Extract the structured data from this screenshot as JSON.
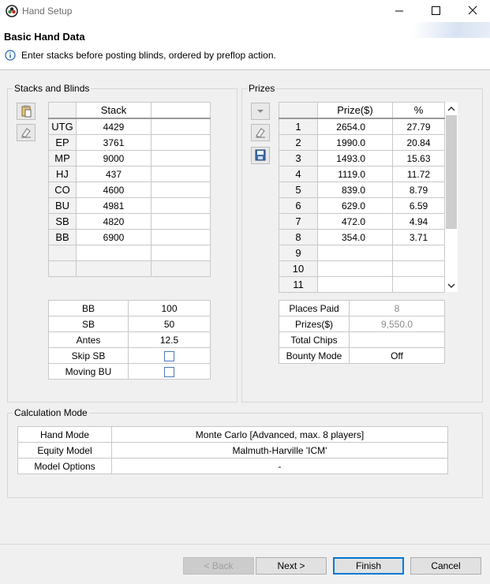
{
  "window": {
    "title": "Hand Setup",
    "controls": [
      "minimize",
      "maximize",
      "close"
    ]
  },
  "header": {
    "title": "Basic Hand Data",
    "info": "Enter stacks before posting blinds, ordered by preflop action."
  },
  "stacks": {
    "group_label": "Stacks and Blinds",
    "column_header": "Stack",
    "rows": [
      {
        "pos": "UTG",
        "stack": "4429"
      },
      {
        "pos": "EP",
        "stack": "3761"
      },
      {
        "pos": "MP",
        "stack": "9000"
      },
      {
        "pos": "HJ",
        "stack": "437"
      },
      {
        "pos": "CO",
        "stack": "4600"
      },
      {
        "pos": "BU",
        "stack": "4981"
      },
      {
        "pos": "SB",
        "stack": "4820"
      },
      {
        "pos": "BB",
        "stack": "6900"
      }
    ],
    "blinds": [
      {
        "label": "BB",
        "value": "100"
      },
      {
        "label": "SB",
        "value": "50"
      },
      {
        "label": "Antes",
        "value": "12.5"
      },
      {
        "label": "Skip SB",
        "checkbox": true
      },
      {
        "label": "Moving BU",
        "checkbox": true
      }
    ]
  },
  "prizes": {
    "group_label": "Prizes",
    "col_prize": "Prize($)",
    "col_pct": "%",
    "rows": [
      {
        "place": "1",
        "prize": "2654.0",
        "pct": "27.79"
      },
      {
        "place": "2",
        "prize": "1990.0",
        "pct": "20.84"
      },
      {
        "place": "3",
        "prize": "1493.0",
        "pct": "15.63"
      },
      {
        "place": "4",
        "prize": "1119.0",
        "pct": "11.72"
      },
      {
        "place": "5",
        "prize": "839.0",
        "pct": "8.79"
      },
      {
        "place": "6",
        "prize": "629.0",
        "pct": "6.59"
      },
      {
        "place": "7",
        "prize": "472.0",
        "pct": "4.94"
      },
      {
        "place": "8",
        "prize": "354.0",
        "pct": "3.71"
      },
      {
        "place": "9",
        "prize": "",
        "pct": ""
      },
      {
        "place": "10",
        "prize": "",
        "pct": ""
      },
      {
        "place": "11",
        "prize": "",
        "pct": ""
      }
    ],
    "summary": [
      {
        "label": "Places Paid",
        "value": "8"
      },
      {
        "label": "Prizes($)",
        "value": "9,550.0"
      },
      {
        "label": "Total Chips",
        "value": ""
      },
      {
        "label": "Bounty Mode",
        "value": "Off"
      }
    ]
  },
  "calc": {
    "group_label": "Calculation Mode",
    "rows": [
      {
        "label": "Hand Mode",
        "value": "Monte Carlo [Advanced, max. 8 players]"
      },
      {
        "label": "Equity Model",
        "value": "Malmuth-Harville 'ICM'"
      },
      {
        "label": "Model Options",
        "value": "-"
      }
    ]
  },
  "buttons": {
    "back": "< Back",
    "next": "Next >",
    "finish": "Finish",
    "cancel": "Cancel"
  }
}
